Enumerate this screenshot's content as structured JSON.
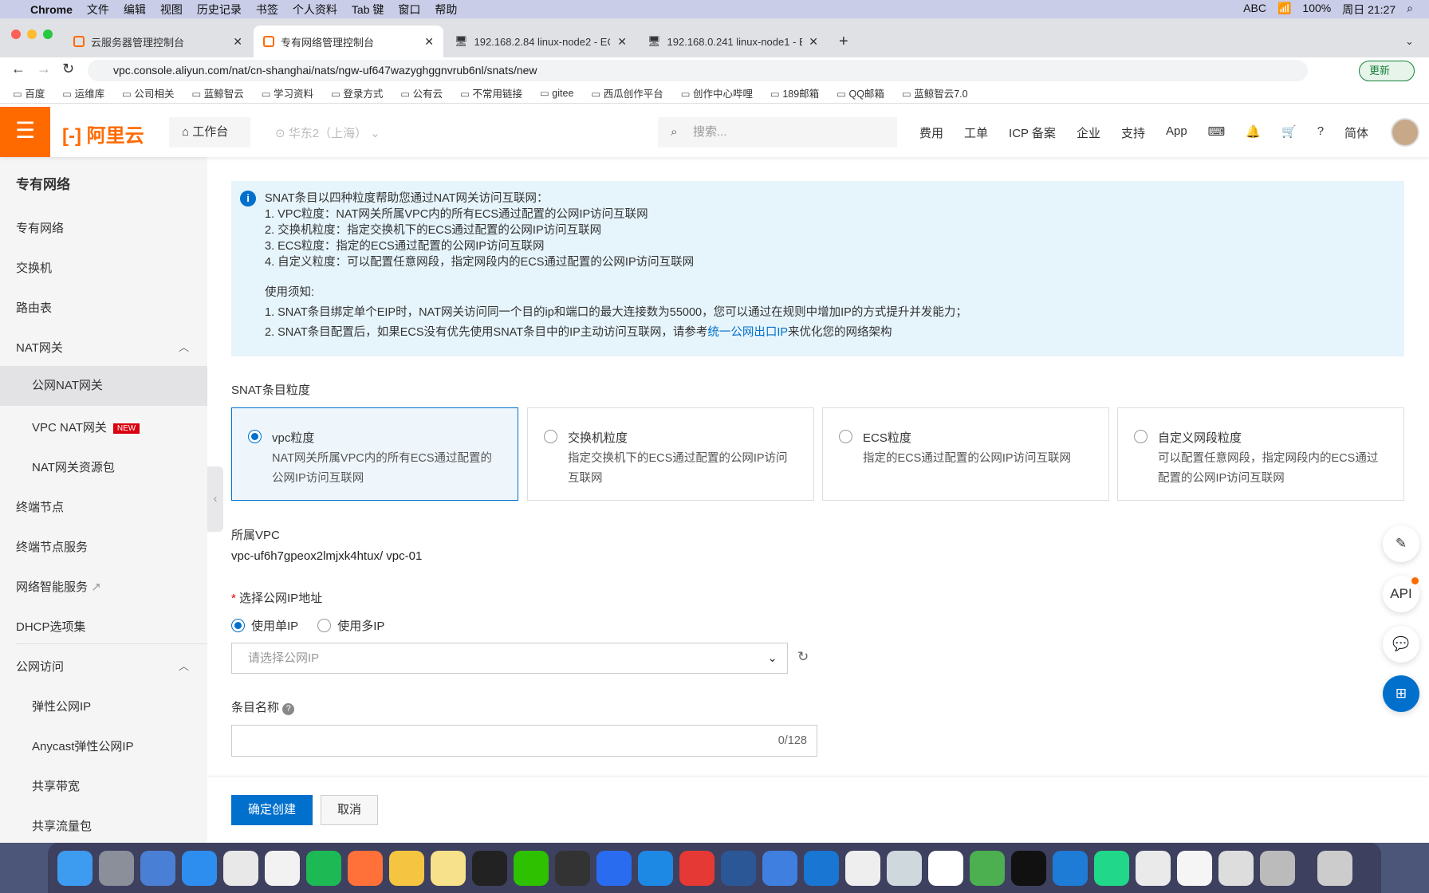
{
  "menubar": {
    "app": "Chrome",
    "items": [
      "文件",
      "编辑",
      "视图",
      "历史记录",
      "书签",
      "个人资料",
      "Tab 键",
      "窗口",
      "帮助"
    ],
    "battery": "100%",
    "clock": "周日 21:27",
    "input": "ABC"
  },
  "tabs": [
    {
      "label": "云服务器管理控制台"
    },
    {
      "label": "专有网络管理控制台",
      "active": true
    },
    {
      "label": "192.168.2.84 linux-node2 - EC"
    },
    {
      "label": "192.168.0.241 linux-node1 - EC"
    }
  ],
  "address": {
    "url": "vpc.console.aliyun.com/nat/cn-shanghai/nats/ngw-uf647wazyghggnvrub6nl/snats/new",
    "update": "更新"
  },
  "bookmarks": [
    "百度",
    "运维库",
    "公司相关",
    "蓝鲸智云",
    "学习资料",
    "登录方式",
    "公有云",
    "不常用链接",
    "gitee",
    "西瓜创作平台",
    "创作中心哔哩",
    "189邮箱",
    "QQ邮箱",
    "蓝鲸智云7.0"
  ],
  "header": {
    "logo": "阿里云",
    "workbench": "工作台",
    "region": "华东2（上海）",
    "search_placeholder": "搜索...",
    "nav": [
      "费用",
      "工单",
      "ICP 备案",
      "企业",
      "支持",
      "App"
    ],
    "lang": "简体"
  },
  "sidebar": {
    "title": "专有网络",
    "items": [
      "专有网络",
      "交换机",
      "路由表",
      "NAT网关",
      "公网NAT网关",
      "VPC NAT网关",
      "NAT网关资源包",
      "终端节点",
      "终端节点服务",
      "网络智能服务",
      "DHCP选项集",
      "公网访问",
      "弹性公网IP",
      "Anycast弹性公网IP",
      "共享带宽",
      "共享流量包"
    ],
    "new_badge": "NEW",
    "selected": "公网NAT网关"
  },
  "info": {
    "lines": [
      "SNAT条目以四种粒度帮助您通过NAT网关访问互联网：",
      "1. VPC粒度：NAT网关所属VPC内的所有ECS通过配置的公网IP访问互联网",
      "2. 交换机粒度：指定交换机下的ECS通过配置的公网IP访问互联网",
      "3. ECS粒度：指定的ECS通过配置的公网IP访问互联网",
      "4. 自定义粒度：可以配置任意网段，指定网段内的ECS通过配置的公网IP访问互联网"
    ],
    "notice_title": "使用须知:",
    "notice1": "1. SNAT条目绑定单个EIP时，NAT网关访问同一个目的ip和端口的最大连接数为55000，您可以通过在规则中增加IP的方式提升并发能力；",
    "notice2_pre": "2. SNAT条目配置后，如果ECS没有优先使用SNAT条目中的IP主动访问互联网，请参考",
    "notice2_link": "统一公网出口IP",
    "notice2_post": "来优化您的网络架构"
  },
  "form": {
    "granularity_label": "SNAT条目粒度",
    "cards": [
      {
        "title": "vpc粒度",
        "desc": "NAT网关所属VPC内的所有ECS通过配置的公网IP访问互联网",
        "selected": true
      },
      {
        "title": "交换机粒度",
        "desc": "指定交换机下的ECS通过配置的公网IP访问互联网"
      },
      {
        "title": "ECS粒度",
        "desc": "指定的ECS通过配置的公网IP访问互联网"
      },
      {
        "title": "自定义网段粒度",
        "desc": "可以配置任意网段，指定网段内的ECS通过配置的公网IP访问互联网"
      }
    ],
    "vpc_label": "所属VPC",
    "vpc_value": "vpc-uf6h7gpeox2lmjxk4htux/ vpc-01",
    "ip_label": "选择公网IP地址",
    "single_ip": "使用单IP",
    "multi_ip": "使用多IP",
    "ip_placeholder": "请选择公网IP",
    "name_label": "条目名称",
    "name_counter": "0/128",
    "submit": "确定创建",
    "cancel": "取消"
  },
  "float": {
    "api": "API"
  },
  "colors": {
    "accent": "#0070cc",
    "brand": "#ff6a00"
  }
}
